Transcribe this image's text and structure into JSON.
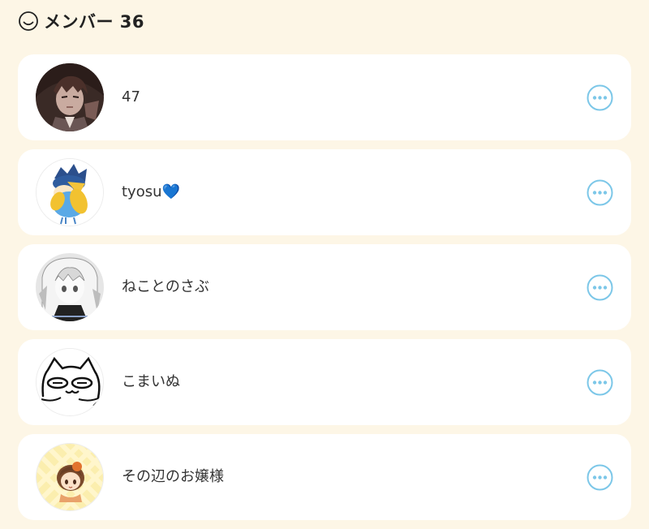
{
  "header": {
    "icon": "smiley-face-icon",
    "title": "メンバー 36"
  },
  "members": [
    {
      "name": "47",
      "avatar": "anime-character-dark-hair-avatar",
      "more_icon": "more-options-icon"
    },
    {
      "name": "tyosu💙",
      "avatar": "blue-bird-character-avatar",
      "more_icon": "more-options-icon"
    },
    {
      "name": "ねことのさぶ",
      "avatar": "monochrome-anime-girl-avatar",
      "more_icon": "more-options-icon"
    },
    {
      "name": "こまいぬ",
      "avatar": "cat-face-line-drawing-avatar",
      "more_icon": "more-options-icon"
    },
    {
      "name": "その辺のお嬢様",
      "avatar": "chibi-girl-yellow-background-avatar",
      "more_icon": "more-options-icon"
    }
  ],
  "colors": {
    "background": "#fdf6e6",
    "card": "#ffffff",
    "accent": "#7cc7e8"
  }
}
